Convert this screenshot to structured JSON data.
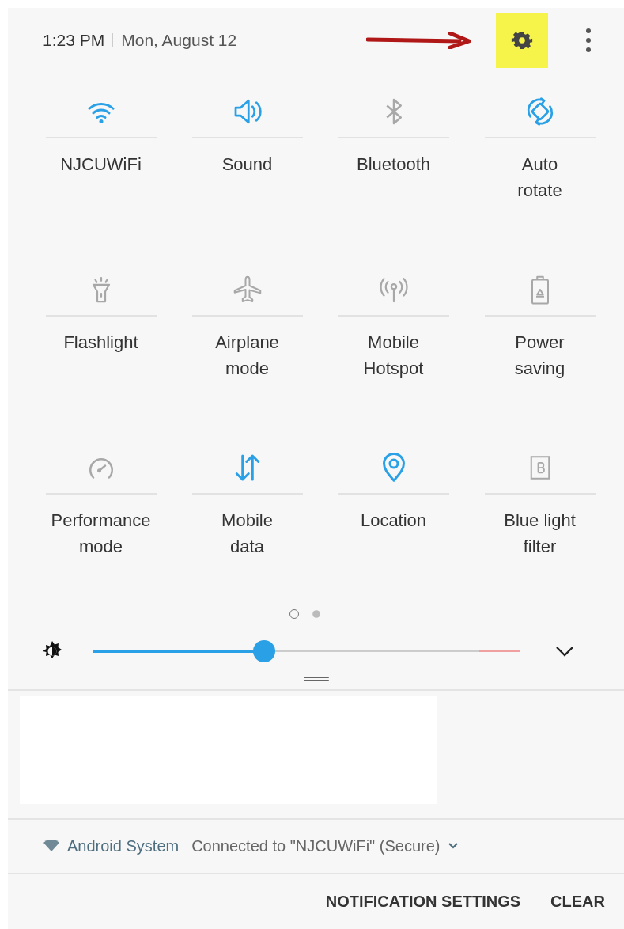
{
  "header": {
    "time": "1:23 PM",
    "date": "Mon, August 12",
    "settings_highlighted": true
  },
  "tiles": [
    {
      "kind": "wifi",
      "label": "NJCUWiFi",
      "on": true
    },
    {
      "kind": "sound",
      "label": "Sound",
      "on": true
    },
    {
      "kind": "bluetooth",
      "label": "Bluetooth",
      "on": false
    },
    {
      "kind": "rotate",
      "label": "Auto rotate",
      "on": true
    },
    {
      "kind": "flashlight",
      "label": "Flashlight",
      "on": false
    },
    {
      "kind": "airplane",
      "label": "Airplane mode",
      "on": false
    },
    {
      "kind": "hotspot",
      "label": "Mobile Hotspot",
      "on": false
    },
    {
      "kind": "battery",
      "label": "Power saving",
      "on": false
    },
    {
      "kind": "gauge",
      "label": "Performance mode",
      "on": false
    },
    {
      "kind": "data",
      "label": "Mobile data",
      "on": true
    },
    {
      "kind": "location",
      "label": "Location",
      "on": true
    },
    {
      "kind": "bluelight",
      "label": "Blue light filter",
      "on": false
    }
  ],
  "pages": [
    {
      "selected": true
    },
    {
      "selected": false
    }
  ],
  "brightness": {
    "level": 0.4
  },
  "notification": {
    "app": "Android System",
    "text": "Connected to \"NJCUWiFi\" (Secure)"
  },
  "actions": [
    "NOTIFICATION SETTINGS",
    "CLEAR"
  ]
}
